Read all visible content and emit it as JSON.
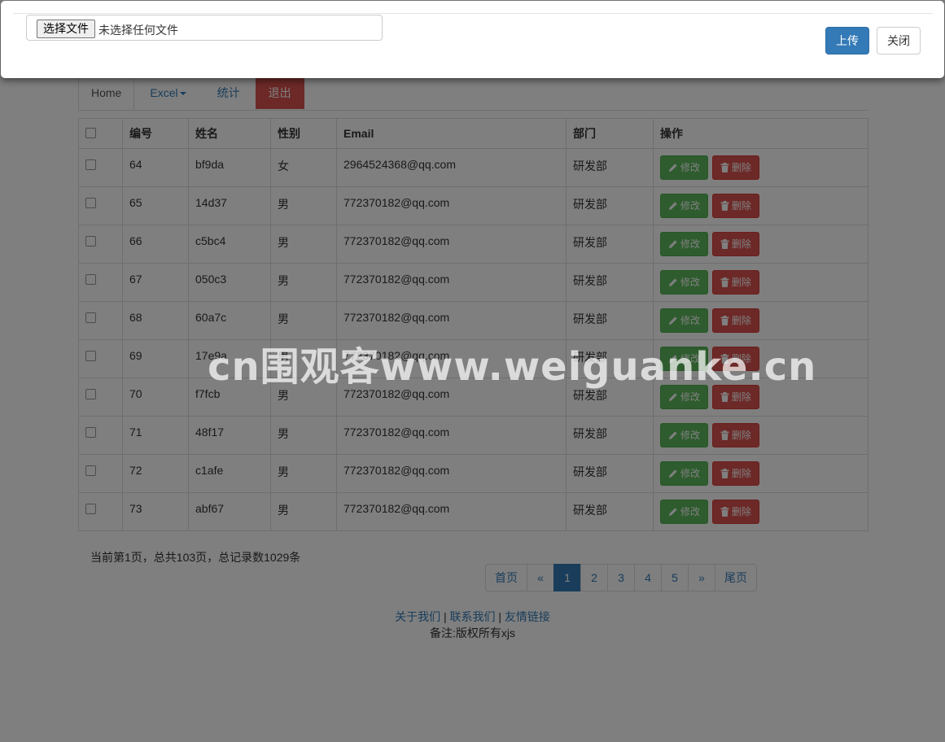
{
  "nav": {
    "tabs": [
      {
        "label": "Home"
      },
      {
        "label": "Excel"
      },
      {
        "label": "统计"
      },
      {
        "label": "退出"
      }
    ]
  },
  "table": {
    "headers": [
      "编号",
      "姓名",
      "性别",
      "Email",
      "部门",
      "操作"
    ],
    "rows": [
      {
        "id": "64",
        "name": "bf9da",
        "gender": "女",
        "email": "2964524368@qq.com",
        "dept": "研发部"
      },
      {
        "id": "65",
        "name": "14d37",
        "gender": "男",
        "email": "772370182@qq.com",
        "dept": "研发部"
      },
      {
        "id": "66",
        "name": "c5bc4",
        "gender": "男",
        "email": "772370182@qq.com",
        "dept": "研发部"
      },
      {
        "id": "67",
        "name": "050c3",
        "gender": "男",
        "email": "772370182@qq.com",
        "dept": "研发部"
      },
      {
        "id": "68",
        "name": "60a7c",
        "gender": "男",
        "email": "772370182@qq.com",
        "dept": "研发部"
      },
      {
        "id": "69",
        "name": "17e9a",
        "gender": "男",
        "email": "772370182@qq.com",
        "dept": "研发部"
      },
      {
        "id": "70",
        "name": "f7fcb",
        "gender": "男",
        "email": "772370182@qq.com",
        "dept": "研发部"
      },
      {
        "id": "71",
        "name": "48f17",
        "gender": "男",
        "email": "772370182@qq.com",
        "dept": "研发部"
      },
      {
        "id": "72",
        "name": "c1afe",
        "gender": "男",
        "email": "772370182@qq.com",
        "dept": "研发部"
      },
      {
        "id": "73",
        "name": "abf67",
        "gender": "男",
        "email": "772370182@qq.com",
        "dept": "研发部"
      }
    ],
    "edit_label": "修改",
    "delete_label": "删除"
  },
  "pagination": {
    "info": "当前第1页，总共103页，总记录数1029条",
    "first": "首页",
    "prev": "«",
    "pages": [
      "1",
      "2",
      "3",
      "4",
      "5"
    ],
    "active_page": "1",
    "next": "»",
    "last": "尾页"
  },
  "footer": {
    "links": [
      "关于我们",
      "联系我们",
      "友情链接"
    ],
    "separator": "|",
    "note": "备注:版权所有xjs"
  },
  "modal": {
    "file_button": "选择文件",
    "file_status": "未选择任何文件",
    "upload_label": "上传",
    "close_label": "关闭"
  },
  "watermark": "cn围观客www.weiguanke.cn",
  "colors": {
    "primary": "#337ab7",
    "success": "#5cb85c",
    "danger": "#d9534f"
  }
}
